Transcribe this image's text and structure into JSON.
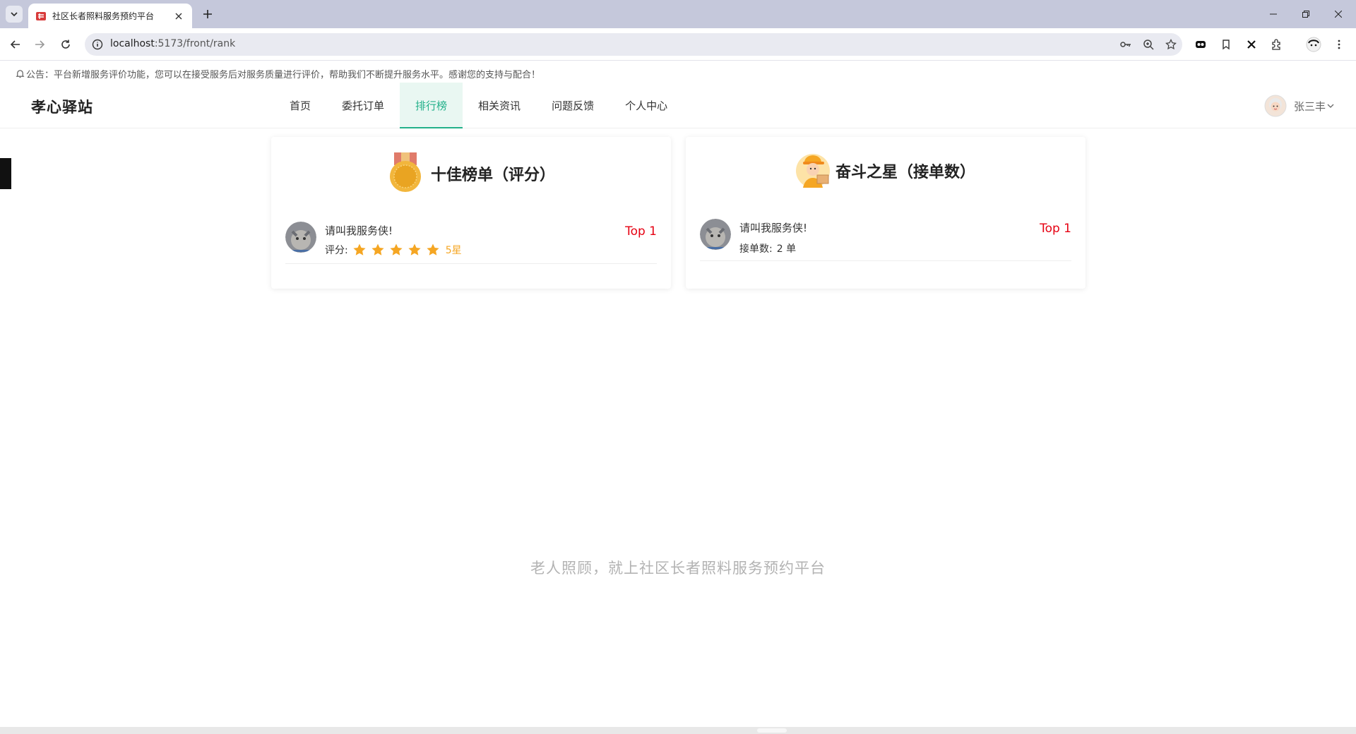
{
  "browser": {
    "tab_title": "社区长者照料服务预约平台",
    "url_host": "localhost",
    "url_rest": ":5173/front/rank"
  },
  "notice": {
    "text": "公告：平台新增服务评价功能，您可以在接受服务后对服务质量进行评价，帮助我们不断提升服务水平。感谢您的支持与配合！"
  },
  "header": {
    "logo": "孝心驿站",
    "nav": [
      {
        "label": "首页",
        "active": false
      },
      {
        "label": "委托订单",
        "active": false
      },
      {
        "label": "排行榜",
        "active": true
      },
      {
        "label": "相关资讯",
        "active": false
      },
      {
        "label": "问题反馈",
        "active": false
      },
      {
        "label": "个人中心",
        "active": false
      }
    ],
    "user_name": "张三丰"
  },
  "rank_rating": {
    "title": "十佳榜单（评分）",
    "icon": "medal-icon",
    "items": [
      {
        "name": "请叫我服务侠!",
        "score_label": "评分:",
        "stars": 5,
        "stars_text": "5星",
        "rank": "Top 1"
      }
    ]
  },
  "rank_orders": {
    "title": "奋斗之星（接单数）",
    "icon": "delivery-man-icon",
    "items": [
      {
        "name": "请叫我服务侠!",
        "orders_label": "接单数:",
        "orders_value": "2 单",
        "rank": "Top 1"
      }
    ]
  },
  "footer": {
    "slogan": "老人照顾，就上社区长者照料服务预约平台"
  },
  "colors": {
    "accent": "#23b08a",
    "rank": "#e60012",
    "star": "#f5a623"
  }
}
